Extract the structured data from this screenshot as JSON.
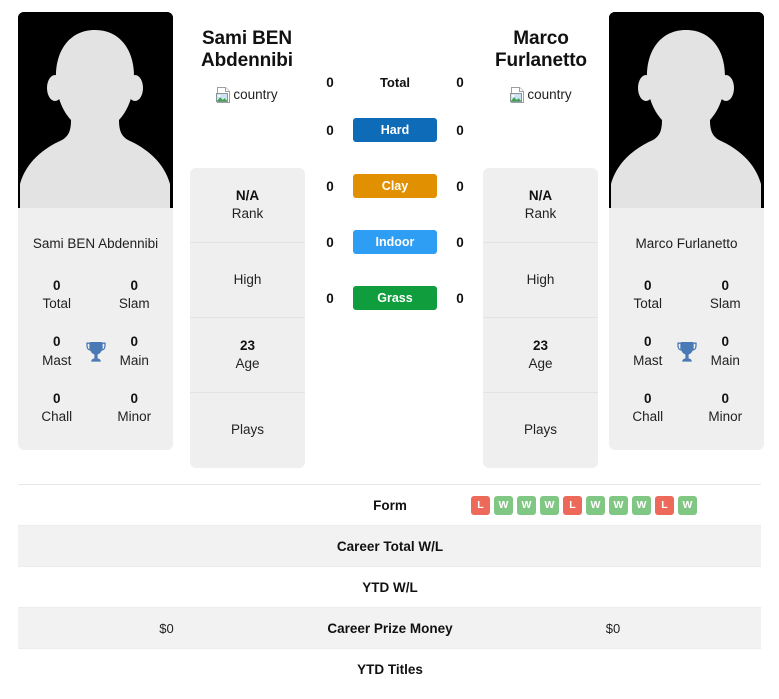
{
  "players": {
    "left": {
      "name": "Sami BEN Abdennibi",
      "display_name_line1": "Sami BEN",
      "display_name_line2": "Abdennibi",
      "country_alt": "country",
      "card_name": "Sami BEN Abdennibi",
      "titles": [
        {
          "value": "0",
          "label": "Total"
        },
        {
          "value": "0",
          "label": "Slam"
        },
        {
          "value": "0",
          "label": "Mast"
        },
        {
          "value": "0",
          "label": "Main"
        },
        {
          "value": "0",
          "label": "Chall"
        },
        {
          "value": "0",
          "label": "Minor"
        }
      ],
      "info": [
        {
          "value": "N/A",
          "label": "Rank"
        },
        {
          "value": "",
          "label": "High"
        },
        {
          "value": "23",
          "label": "Age"
        },
        {
          "value": "",
          "label": "Plays"
        }
      ],
      "surface_counts": [
        "0",
        "0",
        "0",
        "0",
        "0"
      ]
    },
    "right": {
      "name": "Marco Furlanetto",
      "display_name_line1": "Marco",
      "display_name_line2": "Furlanetto",
      "country_alt": "country",
      "card_name": "Marco Furlanetto",
      "titles": [
        {
          "value": "0",
          "label": "Total"
        },
        {
          "value": "0",
          "label": "Slam"
        },
        {
          "value": "0",
          "label": "Mast"
        },
        {
          "value": "0",
          "label": "Main"
        },
        {
          "value": "0",
          "label": "Chall"
        },
        {
          "value": "0",
          "label": "Minor"
        }
      ],
      "info": [
        {
          "value": "N/A",
          "label": "Rank"
        },
        {
          "value": "",
          "label": "High"
        },
        {
          "value": "23",
          "label": "Age"
        },
        {
          "value": "",
          "label": "Plays"
        }
      ],
      "surface_counts": [
        "0",
        "0",
        "0",
        "0",
        "0"
      ]
    }
  },
  "surfaces": [
    {
      "label": "Total",
      "color": "transparent",
      "text_color": "#111111"
    },
    {
      "label": "Hard",
      "color": "#0d6bb8",
      "text_color": "#ffffff"
    },
    {
      "label": "Clay",
      "color": "#e09000",
      "text_color": "#ffffff"
    },
    {
      "label": "Indoor",
      "color": "#2e9df4",
      "text_color": "#ffffff"
    },
    {
      "label": "Grass",
      "color": "#0f9d3e",
      "text_color": "#ffffff"
    }
  ],
  "table": {
    "rows": [
      {
        "label": "Form",
        "left": "",
        "right": "",
        "shaded": false,
        "kind": "form"
      },
      {
        "label": "Career Total W/L",
        "left": "",
        "right": "",
        "shaded": true,
        "kind": "text"
      },
      {
        "label": "YTD W/L",
        "left": "",
        "right": "",
        "shaded": false,
        "kind": "text"
      },
      {
        "label": "Career Prize Money",
        "left": "$0",
        "right": "$0",
        "shaded": true,
        "kind": "text"
      },
      {
        "label": "YTD Titles",
        "left": "",
        "right": "",
        "shaded": false,
        "kind": "text"
      }
    ],
    "form_right": [
      "L",
      "W",
      "W",
      "W",
      "L",
      "W",
      "W",
      "W",
      "L",
      "W"
    ],
    "form_left": []
  },
  "colors": {
    "win_badge": "#81c784",
    "loss_badge": "#ed6a5a",
    "card_bg": "#efefef",
    "row_shade": "#f2f2f2",
    "trophy": "#4a7ab5",
    "photo_bg": "#000000",
    "silhouette": "#e3e3e3"
  },
  "icons": {
    "trophy": "trophy-icon",
    "broken_image": "broken-image-icon",
    "avatar": "avatar-silhouette-icon"
  }
}
